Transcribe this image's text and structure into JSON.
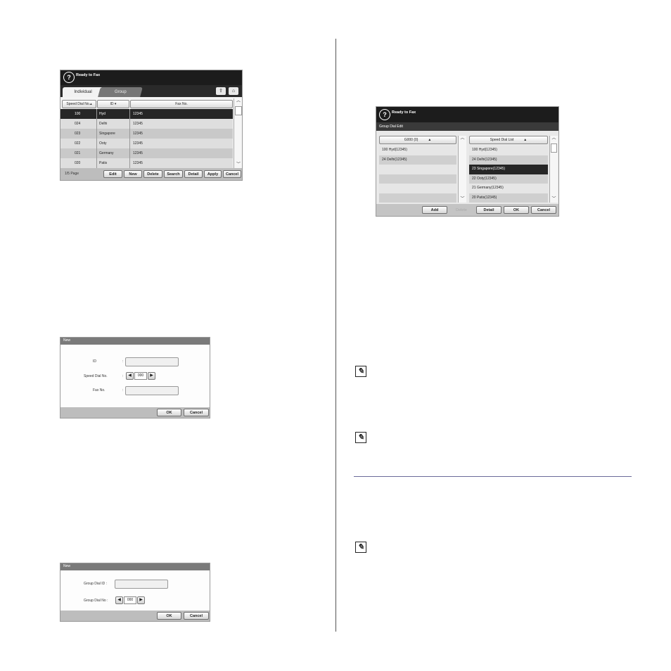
{
  "fax_book": {
    "status_title": "Ready to Fax",
    "tabs": [
      "Individual",
      "Group"
    ],
    "columns": [
      "Speed Dial No.",
      "ID",
      "Fax No."
    ],
    "rows": [
      {
        "speed": "100",
        "id": "Hyd",
        "fax": "12345"
      },
      {
        "speed": "024",
        "id": "Delhi",
        "fax": "12345"
      },
      {
        "speed": "023",
        "id": "Singapore",
        "fax": "12345"
      },
      {
        "speed": "022",
        "id": "Ooty",
        "fax": "12345"
      },
      {
        "speed": "021",
        "id": "Germany",
        "fax": "12345"
      },
      {
        "speed": "020",
        "id": "Patis",
        "fax": "12345"
      }
    ],
    "page_info": "1/5 Page",
    "buttons": [
      "Edit",
      "New",
      "Delete",
      "Search",
      "Detail",
      "Apply",
      "Cancel"
    ]
  },
  "new_individual": {
    "title": "New",
    "id_label": "ID",
    "speed_label": "Speed Dial No.",
    "speed_value": "000",
    "fax_label": "Fax No.",
    "colon": ":",
    "ok": "OK",
    "cancel": "Cancel"
  },
  "new_group": {
    "title": "New",
    "group_id_label": "Group Dial ID :",
    "group_no_label": "Group Dial No :",
    "group_no_value": "000",
    "ok": "OK",
    "cancel": "Cancel"
  },
  "group_edit": {
    "status_title": "Ready to Fax",
    "subtitle": "Group Dial Edit",
    "left_header": "G000 (0)",
    "left_rows": [
      "100  Hyd(12345)",
      "24  Delhi(12345)",
      "",
      "",
      "",
      ""
    ],
    "right_header": "Speed Dial List",
    "right_rows": [
      "100  Hyd(12345)",
      "24  Delhi(12345)",
      "23  Singapore(12345)",
      "22  Ooty(12345)",
      "21  Germany(12345)",
      "20  Patis(12345)"
    ],
    "buttons": {
      "add": "Add",
      "delete": "Delete",
      "detail": "Detail",
      "ok": "OK",
      "cancel": "Cancel"
    }
  },
  "icons": {
    "help": "?",
    "note": "pencil-note-icon",
    "up": "▲",
    "down": "▼",
    "left": "◀",
    "right": "▶"
  }
}
